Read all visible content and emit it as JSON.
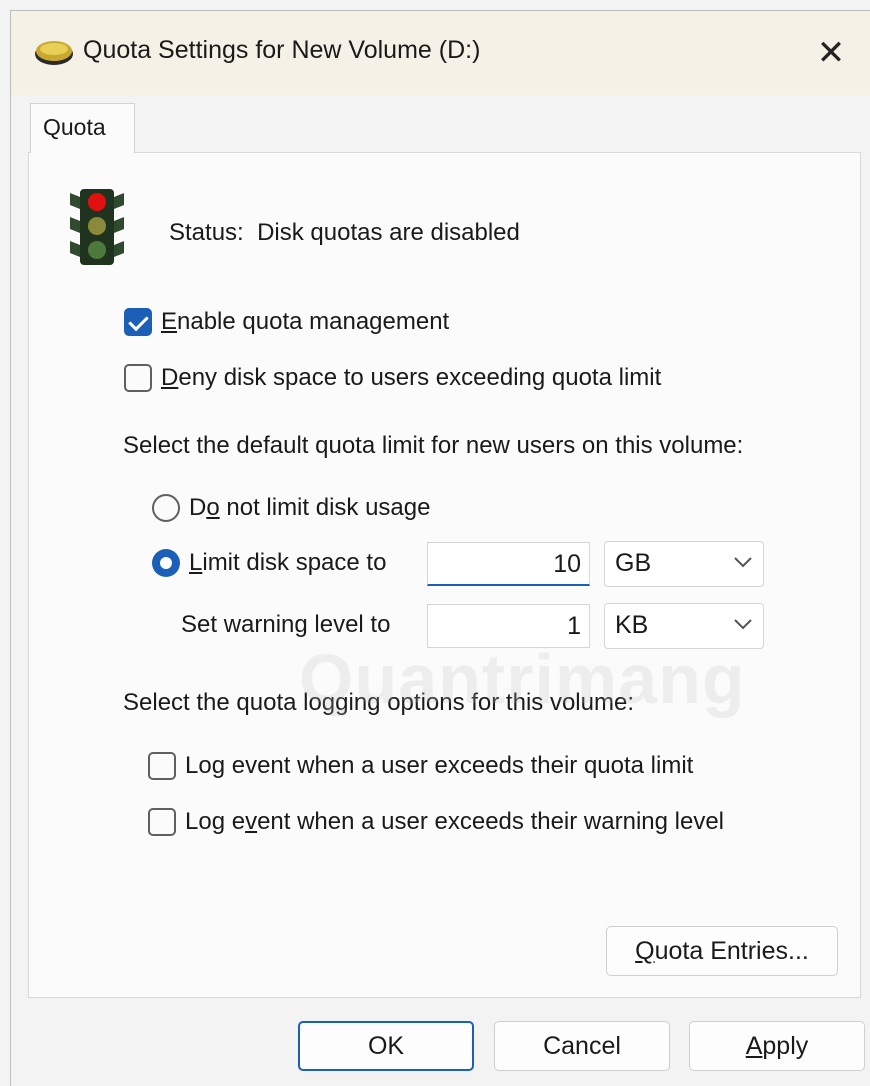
{
  "window": {
    "title": "Quota Settings for New Volume (D:)",
    "close_glyph": "✕",
    "icons": {
      "title": "drive-icon",
      "status": "traffic-light-icon"
    }
  },
  "tabs": [
    {
      "label": "Quota",
      "selected": true
    }
  ],
  "status": {
    "label": "Status:",
    "text": "Disk quotas are disabled"
  },
  "checkboxes": {
    "enable_quota": {
      "mnemonic": "E",
      "rest": "nable quota management",
      "checked": true
    },
    "deny_disk": {
      "mnemonic": "D",
      "rest": "eny disk space to users exceeding quota limit",
      "checked": false
    }
  },
  "default_limit": {
    "heading": "Select the default quota limit for new users on this volume:",
    "no_limit": {
      "pre": "D",
      "mnemonic": "o",
      "rest": " not limit disk usage",
      "selected": false
    },
    "limit": {
      "mnemonic": "L",
      "rest": "imit disk space to",
      "selected": true,
      "value": "10",
      "unit": "GB"
    },
    "warning": {
      "label": "Set warning level to",
      "value": "1",
      "unit": "KB"
    }
  },
  "logging": {
    "heading": "Select the quota logging options for this volume:",
    "log_quota": {
      "pre": "Lo",
      "mnemonic": "g",
      "rest": " event when a user exceeds their quota limit",
      "checked": false
    },
    "log_warning": {
      "pre": "Log e",
      "mnemonic": "v",
      "rest": "ent when a user exceeds their warning level",
      "checked": false
    }
  },
  "buttons": {
    "quota_entries": {
      "mnemonic": "Q",
      "rest": "uota Entries..."
    },
    "ok": "OK",
    "cancel": "Cancel",
    "apply": {
      "mnemonic": "A",
      "rest": "pply"
    }
  },
  "watermark": "Quantrimang",
  "colors": {
    "accent": "#1c5fb8",
    "titlebar": "#f6f1e7",
    "panel": "#fbfbfb"
  }
}
